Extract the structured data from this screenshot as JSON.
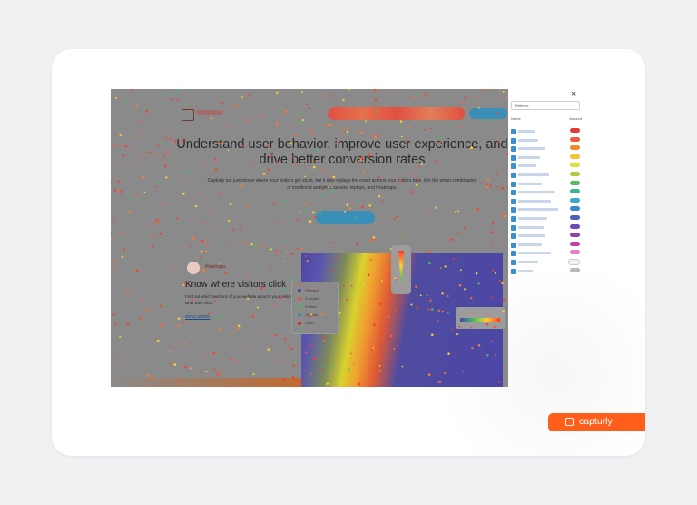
{
  "hero": {
    "title": "Understand user behavior, improve user experience, and drive better conversion rates",
    "subtitle": "Capturly not just shows where your visitors get stuck, but it also replays the exact actions your visitors take. It is the smart combination of traditional analytics, session replays, and heatmaps."
  },
  "feature": {
    "tag": "Heatmaps",
    "title": "Know where visitors click",
    "description": "Find out which sections of your website attracts your visitors or what they miss.",
    "link": "READ MORE"
  },
  "mock_legend": [
    {
      "label": "Premium",
      "color": "#4b46a6"
    },
    {
      "label": "Standard",
      "color": "#e05a35"
    },
    {
      "label": "Further",
      "color": "#4bb865"
    },
    {
      "label": "Organic",
      "color": "#3a8fb8"
    },
    {
      "label": "Direct",
      "color": "#c0392b"
    }
  ],
  "panel": {
    "close": "×",
    "select_value": "Referrer",
    "header_name": "Name",
    "header_amount": "Amount",
    "swatches": [
      "#e53935",
      "#ef5a3a",
      "#f08a2e",
      "#f5c330",
      "#d9e13a",
      "#a8cf3d",
      "#5dbb63",
      "#3fb38a",
      "#3aa7c9",
      "#3b86d0",
      "#4a5fc0",
      "#6a4bb5",
      "#8a44b0",
      "#c040a0",
      "#e57fbf",
      "#f0f0f0",
      "#b8b8b8"
    ]
  },
  "brand": {
    "name": "capturly",
    "accent": "#ff5f1a"
  }
}
